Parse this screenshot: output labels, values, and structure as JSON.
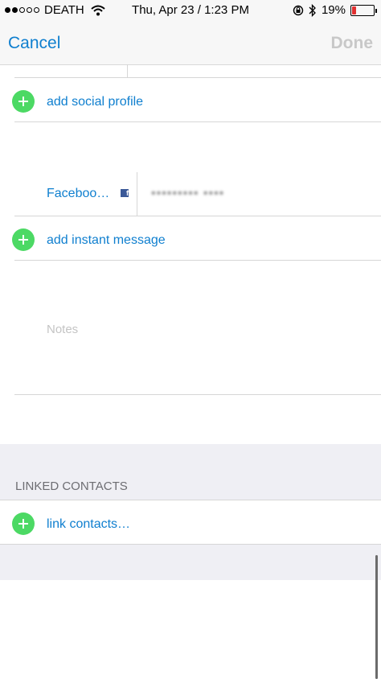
{
  "status_bar": {
    "carrier": "DEATH",
    "datetime": "Thu, Apr 23 / 1:23 PM",
    "battery": "19%",
    "battery_level": 0.19
  },
  "nav": {
    "cancel_label": "Cancel",
    "done_label": "Done"
  },
  "rows": {
    "add_social_profile": "add social profile",
    "facebook_label": "Faceboo…",
    "facebook_value": "••••••••• ••••",
    "add_instant_message": "add instant message",
    "notes_placeholder": "Notes"
  },
  "linked": {
    "header": "LINKED CONTACTS",
    "link_contacts": "link contacts…"
  },
  "colors": {
    "accent": "#0f7fcf",
    "add_green": "#4cd964"
  }
}
